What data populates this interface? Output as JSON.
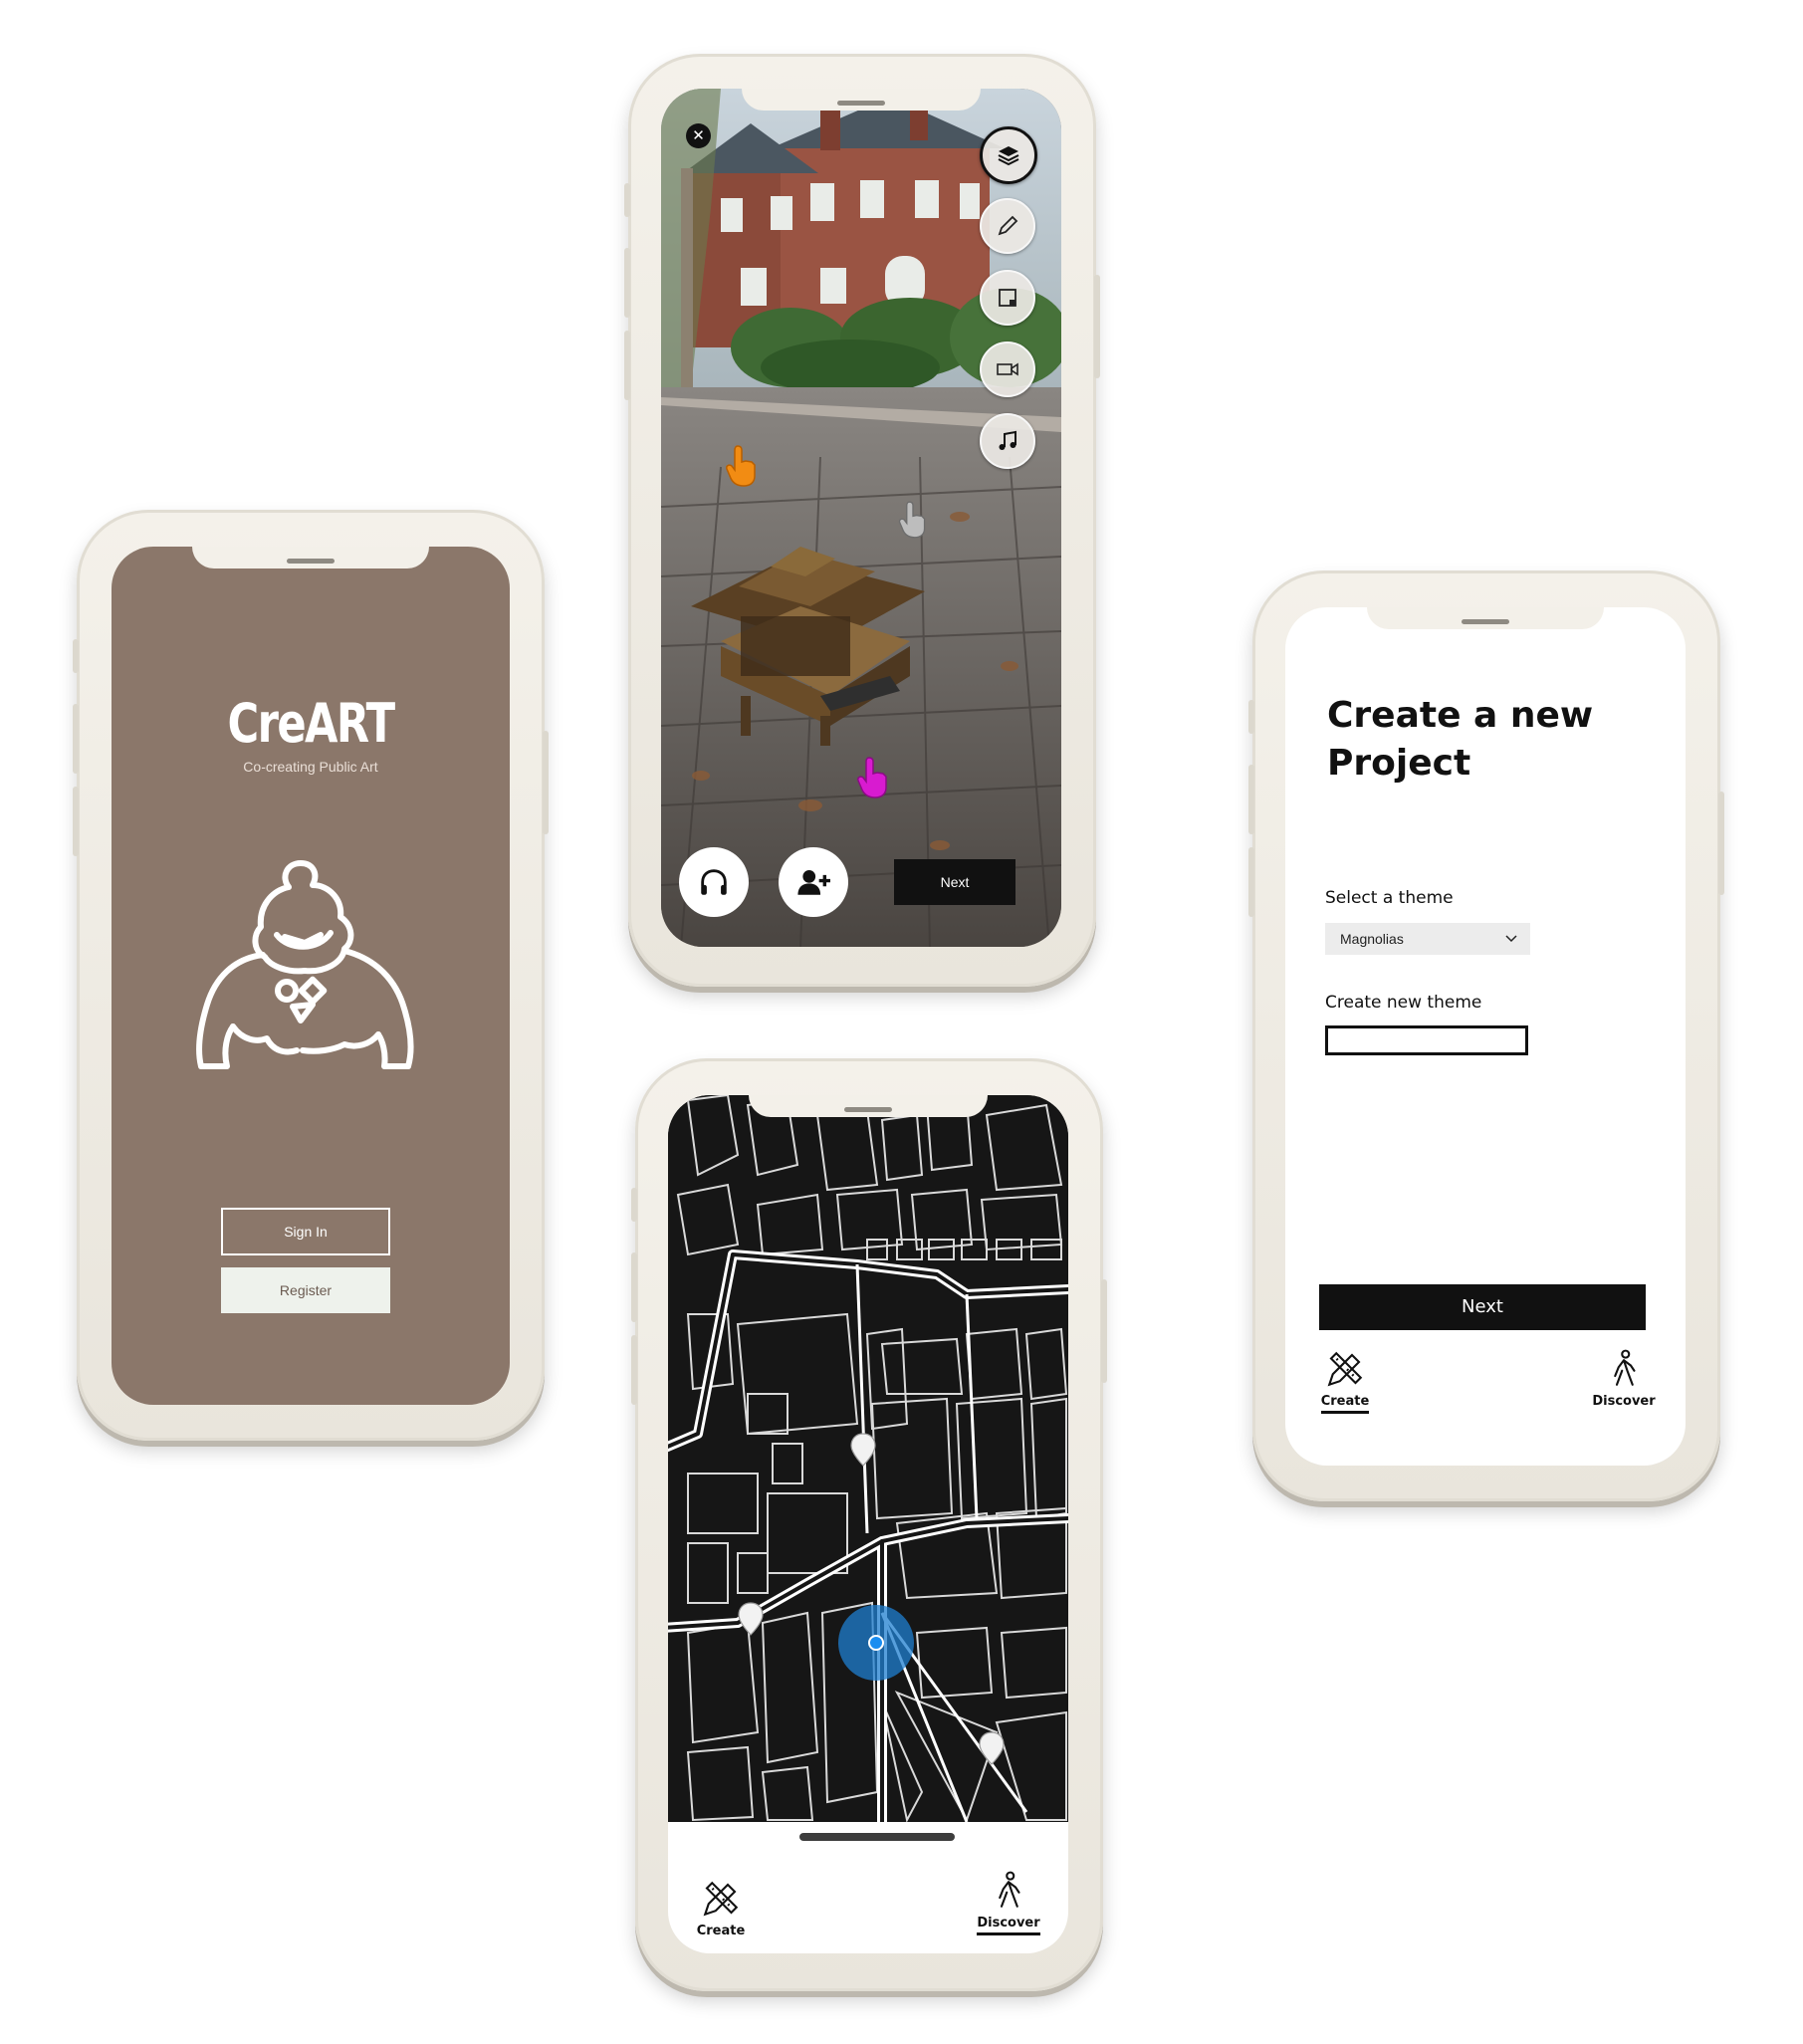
{
  "login_screen": {
    "app_name": "CreART",
    "tagline": "Co-creating Public Art",
    "sign_in_label": "Sign In",
    "register_label": "Register",
    "colors": {
      "background": "#8b776a",
      "register_bg": "#eef2ec"
    }
  },
  "ar_screen": {
    "close_icon": "close-icon",
    "tools": [
      "layers-icon",
      "pencil-icon",
      "crop-icon",
      "video-camera-icon",
      "music-note-icon"
    ],
    "hand_markers": [
      "orange-hand-icon",
      "grey-hand-icon",
      "magenta-hand-icon"
    ],
    "audio_icon": "headphones-icon",
    "add_user_icon": "add-user-icon",
    "next_label": "Next"
  },
  "map_screen": {
    "tabs": [
      {
        "label": "Create",
        "icon": "pencil-ruler-icon",
        "active": false
      },
      {
        "label": "Discover",
        "icon": "walking-person-icon",
        "active": true
      }
    ],
    "location_color": "#1f7fd0"
  },
  "create_project_screen": {
    "title": "Create a new Project",
    "select_theme_label": "Select a theme",
    "selected_theme": "Magnolias",
    "new_theme_label": "Create new theme",
    "new_theme_value": "",
    "next_label": "Next",
    "tabs": [
      {
        "label": "Create",
        "icon": "pencil-ruler-icon",
        "active": true
      },
      {
        "label": "Discover",
        "icon": "walking-person-icon",
        "active": false
      }
    ]
  }
}
